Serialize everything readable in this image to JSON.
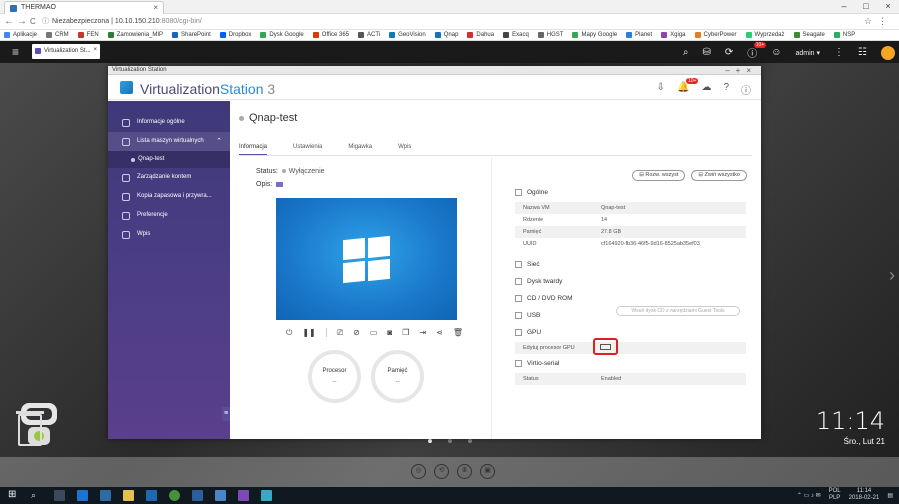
{
  "browser": {
    "tab_title": "THERMAO",
    "nav_back": "←",
    "nav_forward": "→",
    "nav_reload": "C",
    "security_label": "Niezabezpieczona",
    "url_host": "10.10.150.210",
    "url_rest": ":8080/cgi-bin/",
    "bookmarks": [
      "Aplikacje",
      "CRM",
      "FEN",
      "Zamowienia_MIP",
      "SharePoint",
      "Dropbox",
      "Dysk Google",
      "Office 365",
      "ACTi",
      "GeoVision",
      "Qnap",
      "Dahua",
      "Exacq",
      "HGST",
      "Mapy Google",
      "Planet",
      "Xgiga",
      "CyberPower",
      "Wyprzedaż",
      "Seagate",
      "NSP"
    ]
  },
  "qts": {
    "menu_icon": "≡",
    "task_label": "Virtualization St...",
    "user": "admin",
    "notification_count": "10+"
  },
  "app": {
    "window_title": "Virtualization Station",
    "name_part1": "Virtualization",
    "name_part2": "Station",
    "name_version": " 3",
    "header_badge": "10+",
    "sidebar": {
      "items": [
        {
          "label": "Informacje ogólne"
        },
        {
          "label": "Lista maszyn wirtualnych"
        },
        {
          "label": "Zarządzanie kontem"
        },
        {
          "label": "Kopia zapasowa i przywra..."
        },
        {
          "label": "Preferencje"
        },
        {
          "label": "Wpis"
        }
      ],
      "sub_item": "Qnap-test"
    },
    "vm_name": "Qnap-test",
    "tabs": [
      "Informacja",
      "Ustawienia",
      "Migawka",
      "Wpis"
    ],
    "status_label": "Status:",
    "status_value": "Wyłączenie",
    "desc_label": "Opis:",
    "gauges": {
      "cpu_label": "Procesor",
      "cpu_value": "--",
      "mem_label": "Pamięć",
      "mem_value": "--"
    },
    "expand_all": "⊟ Rozw. wszyst",
    "collapse_all": "⊟ Zwiń wszystko",
    "sections": {
      "general": "Ogólne",
      "network": "Sieć",
      "disk": "Dysk twardy",
      "cdrom": "CD / DVD ROM",
      "usb": "USB",
      "gpu": "GPU",
      "virtio": "Virtio-serial"
    },
    "general_rows": [
      {
        "key": "Nazwa VM",
        "value": "Qnap-test"
      },
      {
        "key": "Rdzenie",
        "value": "14"
      },
      {
        "key": "Pamięć",
        "value": "27.8 GB"
      },
      {
        "key": "UUID",
        "value": "cf164920-fb36-46f5-9d16-8525ab35ef03"
      }
    ],
    "cd_button": "Wsuń dysk CD z narzędziami Guest Tools",
    "gpu_row_label": "Edytuj procesor GPU",
    "virtio_row": {
      "key": "Status",
      "value": "Enabled"
    }
  },
  "desktop": {
    "time": "11:14",
    "date": "Śro., Lut 21"
  },
  "taskbar": {
    "lang_top": "POL",
    "lang_bottom": "PLP",
    "time": "11:14",
    "date": "2018-02-21"
  }
}
